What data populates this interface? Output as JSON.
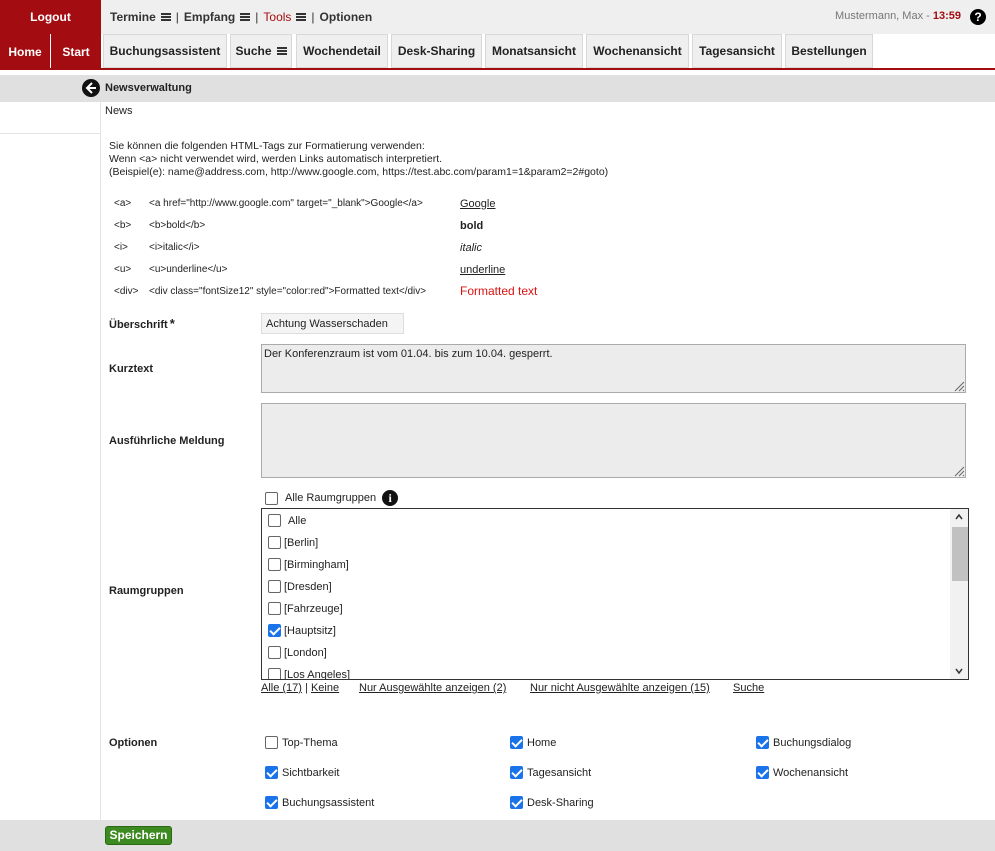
{
  "topbar": {
    "logout": "Logout",
    "menu": [
      {
        "label": "Termine",
        "sep": "|"
      },
      {
        "label": "Empfang",
        "sep": "|"
      },
      {
        "label": "Tools",
        "sep": "|"
      },
      {
        "label": "Optionen"
      }
    ],
    "user": "Mustermann, Max - ",
    "time": "13:59",
    "help": "?"
  },
  "navbar": {
    "home": "Home",
    "start": "Start",
    "tabs": [
      "Buchungsassistent",
      "Suche",
      "Wochendetail",
      "Desk-Sharing",
      "Monatsansicht",
      "Wochenansicht",
      "Tagesansicht",
      "Bestellungen"
    ]
  },
  "page": {
    "title": "Newsverwaltung",
    "crumb": "News",
    "intro_1": "Sie können die folgenden HTML-Tags zur Formatierung verwenden:",
    "intro_2": "Wenn <a> nicht verwendet wird, werden Links automatisch interpretiert.",
    "intro_3": "(Beispiel(e): name@address.com, http://www.google.com, https://test.abc.com/param1=1&param2=2#goto)"
  },
  "tags": [
    {
      "tag": "<a>",
      "code": "<a href=\"http://www.google.com\" target=\"_blank\">Google</a>",
      "example": "Google"
    },
    {
      "tag": "<b>",
      "code": "<b>bold</b>",
      "example": "bold"
    },
    {
      "tag": "<i>",
      "code": "<i>italic</i>",
      "example": "italic"
    },
    {
      "tag": "<u>",
      "code": "<u>underline</u>",
      "example": "underline"
    },
    {
      "tag": "<div>",
      "code": "<div class=\"fontSize12\" style=\"color:red\">Formatted text</div>",
      "example": "Formatted text"
    }
  ],
  "form": {
    "headline_label": "Überschrift",
    "required_mark": "*",
    "headline_value": "Achtung Wasserschaden",
    "short_label": "Kurztext",
    "short_value": "Der Konferenzraum ist vom 01.04. bis zum 10.04. gesperrt.",
    "long_label": "Ausführliche Meldung",
    "long_value": "",
    "groups_label": "Raumgruppen",
    "all_groups_label": "Alle Raumgruppen",
    "all_groups_checked": false,
    "groups": [
      {
        "label": "Alle",
        "checked": false
      },
      {
        "label": "[Berlin]",
        "checked": false
      },
      {
        "label": "[Birmingham]",
        "checked": false
      },
      {
        "label": "[Dresden]",
        "checked": false
      },
      {
        "label": "[Fahrzeuge]",
        "checked": false
      },
      {
        "label": "[Hauptsitz]",
        "checked": true
      },
      {
        "label": "[London]",
        "checked": false
      },
      {
        "label": "[Los Angeles]",
        "checked": false
      }
    ],
    "links": {
      "all": "Alle (17)",
      "sep": "|",
      "none": "Keine",
      "only_selected": "Nur Ausgewählte anzeigen (2)",
      "only_unselected": "Nur nicht Ausgewählte anzeigen (15)",
      "search": "Suche"
    },
    "options_label": "Optionen",
    "options": [
      {
        "label": "Top-Thema",
        "checked": false
      },
      {
        "label": "Home",
        "checked": true
      },
      {
        "label": "Buchungsdialog",
        "checked": true
      },
      {
        "label": "Sichtbarkeit",
        "checked": true
      },
      {
        "label": "Tagesansicht",
        "checked": true
      },
      {
        "label": "Wochenansicht",
        "checked": true
      },
      {
        "label": "Buchungsassistent",
        "checked": true
      },
      {
        "label": "Desk-Sharing",
        "checked": true
      }
    ]
  },
  "footer": {
    "save": "Speichern"
  },
  "colors": {
    "brand_red": "#a30d11",
    "save_green": "#3d8a21",
    "check_blue": "#1a73e8"
  }
}
